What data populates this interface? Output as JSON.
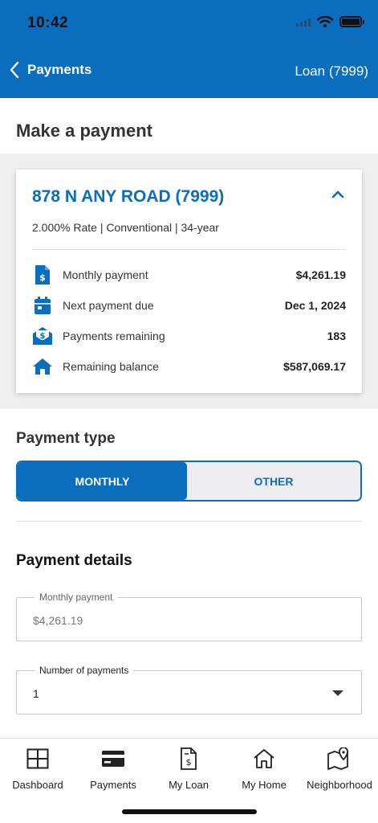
{
  "status_bar": {
    "time": "10:42"
  },
  "header": {
    "back_label": "Payments",
    "loan_label": "Loan (7999)"
  },
  "page": {
    "title": "Make a payment"
  },
  "loan_card": {
    "address": "878 N ANY ROAD (7999)",
    "subtitle": "2.000% Rate | Conventional | 34-year",
    "rows": [
      {
        "label": "Monthly payment",
        "value": "$4,261.19",
        "icon": "invoice-dollar-icon"
      },
      {
        "label": "Next payment due",
        "value": "Dec 1, 2024",
        "icon": "calendar-icon"
      },
      {
        "label": "Payments remaining",
        "value": "183",
        "icon": "money-envelope-icon"
      },
      {
        "label": "Remaining balance",
        "value": "$587,069.17",
        "icon": "house-icon"
      }
    ]
  },
  "payment_type": {
    "title": "Payment type",
    "options": [
      "MONTHLY",
      "OTHER"
    ],
    "selected": "MONTHLY"
  },
  "payment_details": {
    "title": "Payment details",
    "monthly_payment": {
      "label": "Monthly payment",
      "value": "$4,261.19"
    },
    "number_of_payments": {
      "label": "Number of payments",
      "value": "1"
    }
  },
  "bottom_nav": {
    "tabs": [
      {
        "label": "Dashboard",
        "icon": "dashboard-grid-icon"
      },
      {
        "label": "Payments",
        "icon": "credit-card-icon"
      },
      {
        "label": "My Loan",
        "icon": "loan-document-icon"
      },
      {
        "label": "My Home",
        "icon": "home-outline-icon"
      },
      {
        "label": "Neighborhood",
        "icon": "map-pin-icon"
      }
    ]
  },
  "colors": {
    "brand_blue": "#0a6dbd",
    "gray_bg": "#efefef",
    "toggle_off_bg": "#eeeef2"
  }
}
